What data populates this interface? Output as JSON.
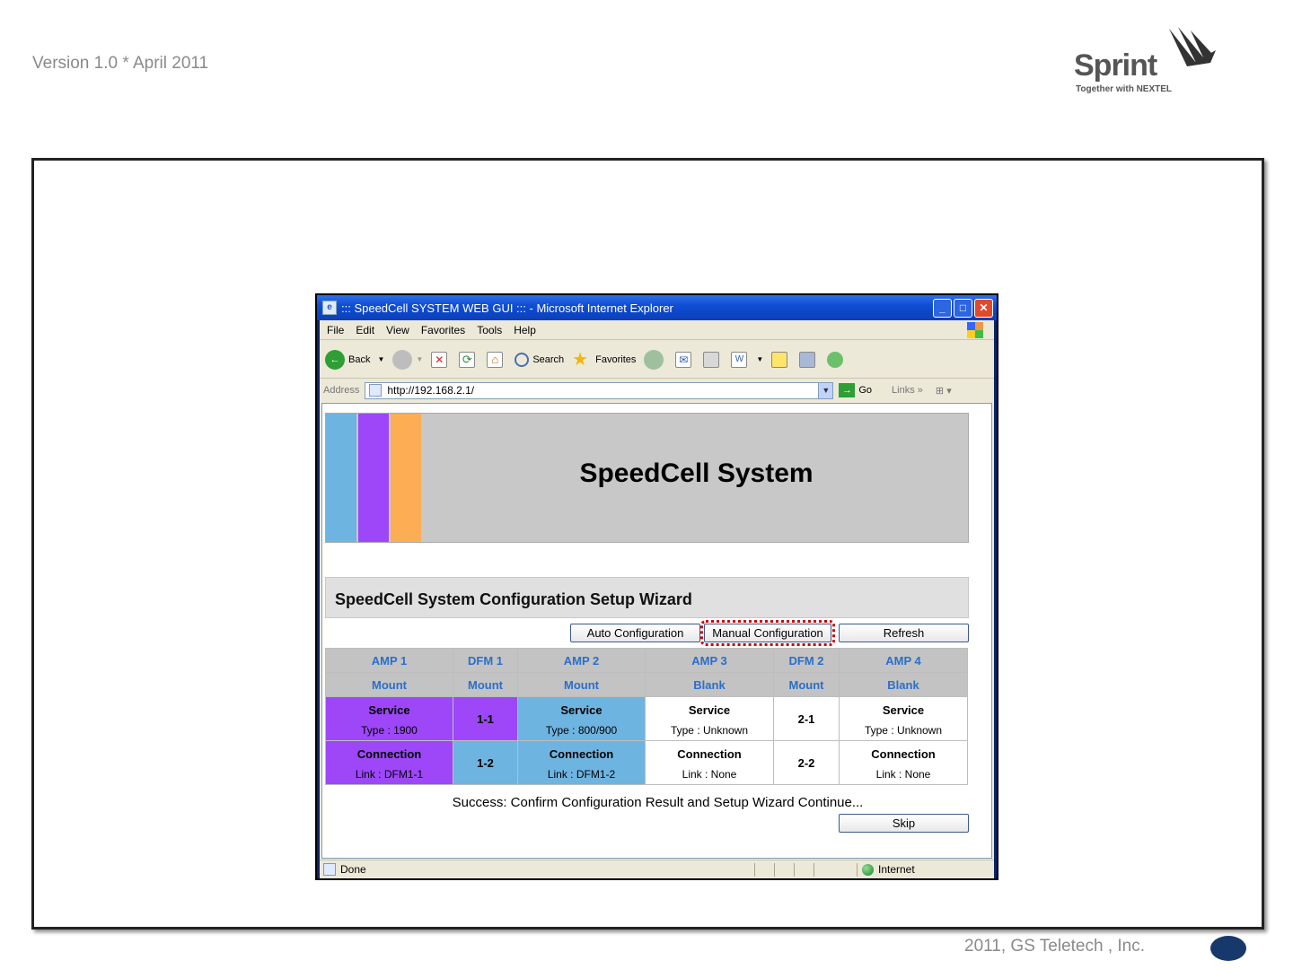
{
  "slide": {
    "version_text": "Version 1.0 * April 2011",
    "logo_word": "Sprint",
    "logo_tagline": "Together with NEXTEL",
    "footer_text": "2011, GS Teletech , Inc."
  },
  "window": {
    "title": "::: SpeedCell SYSTEM WEB GUI ::: - Microsoft Internet Explorer",
    "menu": [
      "File",
      "Edit",
      "View",
      "Favorites",
      "Tools",
      "Help"
    ],
    "toolbar": {
      "back": "Back",
      "search": "Search",
      "favorites": "Favorites"
    },
    "address_label": "Address",
    "address_value": "http://192.168.2.1/",
    "go_label": "Go",
    "links_label": "Links",
    "status_text": "Done",
    "zone_text": "Internet"
  },
  "page": {
    "banner_title": "SpeedCell System",
    "banner_colors": [
      "#6eb4e0",
      "#9d47f9",
      "#fdae55"
    ],
    "wizard_title": "SpeedCell System Configuration Setup Wizard",
    "buttons": {
      "auto": "Auto Configuration",
      "manual": "Manual Configuration",
      "refresh": "Refresh",
      "skip": "Skip"
    },
    "columns": [
      {
        "name": "AMP 1",
        "state": "Mount"
      },
      {
        "name": "DFM 1",
        "state": "Mount"
      },
      {
        "name": "AMP 2",
        "state": "Mount"
      },
      {
        "name": "AMP 3",
        "state": "Blank"
      },
      {
        "name": "DFM 2",
        "state": "Mount"
      },
      {
        "name": "AMP 4",
        "state": "Blank"
      }
    ],
    "cells": {
      "amp1": {
        "service_label": "Service",
        "type": "Type : 1900",
        "connection_label": "Connection",
        "link": "Link : DFM1-1"
      },
      "dfm1": {
        "slot_a": "1-1",
        "slot_b": "1-2"
      },
      "amp2": {
        "service_label": "Service",
        "type": "Type : 800/900",
        "connection_label": "Connection",
        "link": "Link : DFM1-2"
      },
      "amp3": {
        "service_label": "Service",
        "type": "Type : Unknown",
        "connection_label": "Connection",
        "link": "Link : None"
      },
      "dfm2": {
        "slot_a": "2-1",
        "slot_b": "2-2"
      },
      "amp4": {
        "service_label": "Service",
        "type": "Type : Unknown",
        "connection_label": "Connection",
        "link": "Link : None"
      }
    },
    "result_message": "Success: Confirm Configuration Result and Setup Wizard Continue..."
  }
}
